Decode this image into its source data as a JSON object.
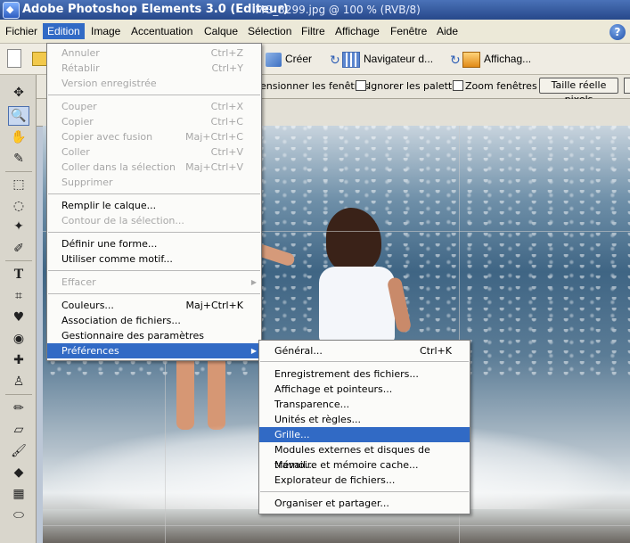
{
  "window": {
    "title": "Adobe Photoshop Elements 3.0 (Editeur)",
    "document": "IMG_3299.jpg @ 100 % (RVB/8)"
  },
  "menubar": {
    "items": [
      "Fichier",
      "Edition",
      "Image",
      "Accentuation",
      "Calque",
      "Sélection",
      "Filtre",
      "Affichage",
      "Fenêtre",
      "Aide"
    ],
    "active": "Edition",
    "help": "?"
  },
  "toolbar": {
    "create": "Créer",
    "navigator": "Navigateur d...",
    "display": "Affichag..."
  },
  "options": {
    "resize_windows": "ensionner les fenêtres",
    "ignore_palettes": "Ignorer les palettes",
    "zoom_windows": "Zoom fenêtres",
    "actual_pixels": "Taille réelle pixels"
  },
  "edit_menu": {
    "undo": {
      "label": "Annuler",
      "shortcut": "Ctrl+Z"
    },
    "redo": {
      "label": "Rétablir",
      "shortcut": "Ctrl+Y"
    },
    "saved_version": {
      "label": "Version enregistrée"
    },
    "cut": {
      "label": "Couper",
      "shortcut": "Ctrl+X"
    },
    "copy": {
      "label": "Copier",
      "shortcut": "Ctrl+C"
    },
    "copy_merged": {
      "label": "Copier avec fusion",
      "shortcut": "Maj+Ctrl+C"
    },
    "paste": {
      "label": "Coller",
      "shortcut": "Ctrl+V"
    },
    "paste_into": {
      "label": "Coller dans la sélection",
      "shortcut": "Maj+Ctrl+V"
    },
    "delete": {
      "label": "Supprimer"
    },
    "fill_layer": {
      "label": "Remplir le calque..."
    },
    "stroke_selection": {
      "label": "Contour de la sélection..."
    },
    "define_shape": {
      "label": "Définir une forme..."
    },
    "define_pattern": {
      "label": "Utiliser comme motif..."
    },
    "purge": {
      "label": "Effacer"
    },
    "colors": {
      "label": "Couleurs...",
      "shortcut": "Maj+Ctrl+K"
    },
    "file_assoc": {
      "label": "Association de fichiers..."
    },
    "preset_manager": {
      "label": "Gestionnaire des paramètres prédéfinis..."
    },
    "preferences": {
      "label": "Préférences"
    }
  },
  "prefs_menu": {
    "general": {
      "label": "Général...",
      "shortcut": "Ctrl+K"
    },
    "saving": {
      "label": "Enregistrement des fichiers..."
    },
    "display_cursors": {
      "label": "Affichage et pointeurs..."
    },
    "transparency": {
      "label": "Transparence..."
    },
    "units_rulers": {
      "label": "Unités et règles..."
    },
    "grid": {
      "label": "Grille..."
    },
    "plugins": {
      "label": "Modules externes et disques de travail..."
    },
    "memory": {
      "label": "Mémoire et mémoire cache..."
    },
    "file_browser": {
      "label": "Explorateur de fichiers..."
    },
    "organize_share": {
      "label": "Organiser et partager..."
    }
  },
  "colors": {
    "accent": "#316ac5",
    "disabled": "#a7a7a7"
  }
}
